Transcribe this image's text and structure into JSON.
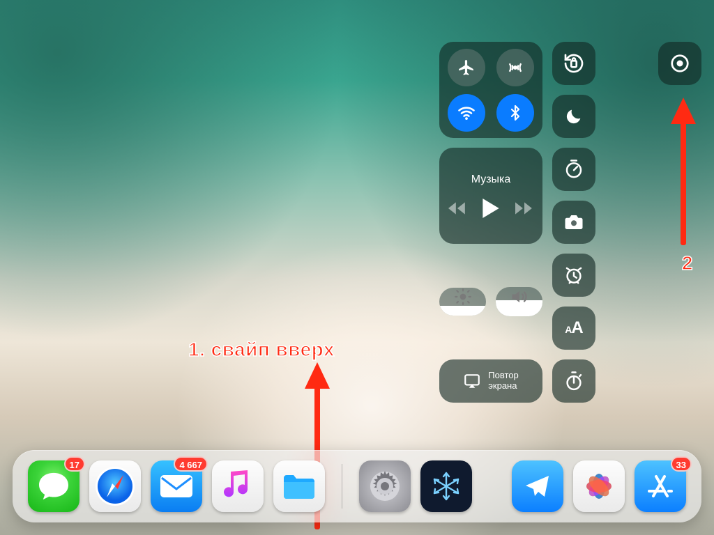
{
  "control_center": {
    "music_label": "Музыка",
    "screen_mirroring_label_line1": "Повтор",
    "screen_mirroring_label_line2": "экрана",
    "brightness_percent": 35,
    "volume_percent": 55,
    "connectivity": {
      "airplane_mode": false,
      "cellular_data": false,
      "wifi": true,
      "bluetooth": true
    },
    "right_column": [
      "orientation-lock",
      "do-not-disturb",
      "timer",
      "camera",
      "alarm",
      "text-size",
      "stopwatch"
    ],
    "screen_recording": true
  },
  "dock": {
    "apps_left": [
      {
        "name": "messages",
        "badge": "17"
      },
      {
        "name": "safari",
        "badge": ""
      },
      {
        "name": "mail",
        "badge": "4 667"
      },
      {
        "name": "music",
        "badge": ""
      },
      {
        "name": "files",
        "badge": ""
      }
    ],
    "apps_right": [
      {
        "name": "settings",
        "badge": ""
      },
      {
        "name": "custom-snow",
        "badge": ""
      },
      {
        "name": "telegram",
        "badge": ""
      },
      {
        "name": "photos",
        "badge": ""
      },
      {
        "name": "appstore",
        "badge": "33"
      }
    ]
  },
  "annotations": {
    "label1": "1. свайп вверх",
    "label2": "2"
  },
  "colors": {
    "accent_blue": "#0a7cff",
    "annotation_red": "#ff2a12",
    "badge_red": "#ff3b30"
  }
}
